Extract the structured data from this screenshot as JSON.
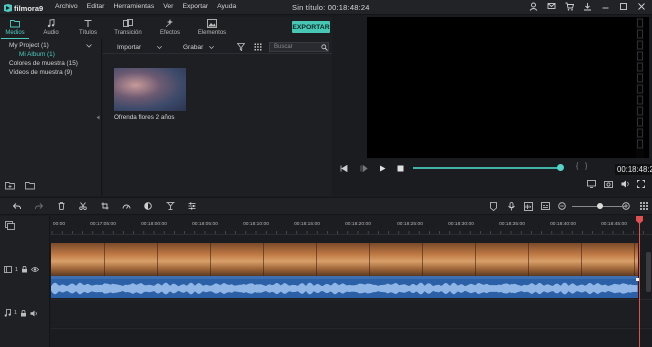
{
  "app": {
    "logo_text": "filmora9",
    "title": "Sin título:",
    "title_time": "00:18:48:24"
  },
  "menu": [
    "Archivo",
    "Editar",
    "Herramientas",
    "Ver",
    "Exportar",
    "Ayuda"
  ],
  "tabs": [
    {
      "label": "Medios",
      "icon": "folder-icon",
      "active": true
    },
    {
      "label": "Audio",
      "icon": "music-note-icon",
      "active": false
    },
    {
      "label": "Títulos",
      "icon": "text-icon",
      "active": false
    },
    {
      "label": "Transición",
      "icon": "transition-icon",
      "active": false
    },
    {
      "label": "Efectos",
      "icon": "effects-icon",
      "active": false
    },
    {
      "label": "Elementos",
      "icon": "image-icon",
      "active": false
    }
  ],
  "export_label": "EXPORTAR",
  "library": {
    "items": [
      "My Project (1)",
      "Mi Album (1)",
      "Colores de muestra (15)",
      "Vídeos de muestra (9)"
    ]
  },
  "media_toolbar": {
    "import_label": "Importar",
    "record_label": "Grabar",
    "search_placeholder": "Buscar"
  },
  "media_items": [
    {
      "label": "Ofrenda flores 2 años"
    }
  ],
  "preview": {
    "time": "00:18:48:24",
    "progress": 0.99
  },
  "timeline": {
    "ruler_labels": [
      "00:00",
      "00:17:05:00",
      "00:18:00:00",
      "00:18:05:00",
      "00:18:10:00",
      "00:18:15:00",
      "00:18:20:00",
      "00:18:25:00",
      "00:18:30:00",
      "00:18:35:00",
      "00:18:40:00",
      "00:18:45:00"
    ],
    "video_track_number": "1",
    "audio_track_number": "1",
    "zoom_level": 0.45
  },
  "colors": {
    "accent": "#4ecac0",
    "export_button": "#48c7b4",
    "playhead": "#e05050",
    "audio_wave": "#2b5fa6"
  }
}
